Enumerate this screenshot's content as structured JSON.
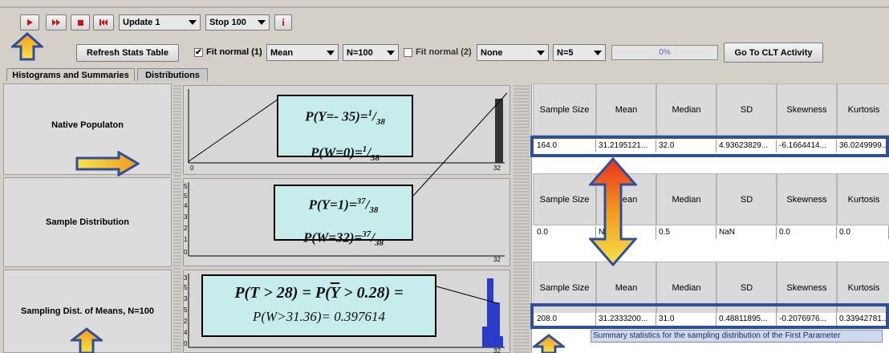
{
  "toolbar": {
    "update_select": "Update 1",
    "stop_select": "Stop 100",
    "info_label": "i"
  },
  "controls": {
    "refresh_label": "Refresh Stats Table",
    "fit1_label": "Fit normal (1)",
    "fit1_checked": true,
    "stat_select": "Mean",
    "n_select": "N=100",
    "fit2_label": "Fit normal (2)",
    "fit2_checked": false,
    "stat2_select": "None",
    "n2_select": "N=5",
    "progress_text": "0%",
    "progress_value": 0,
    "clt_label": "Go To CLT Activity"
  },
  "tabs": [
    {
      "label": "Histograms and Summaries"
    },
    {
      "label": "Distributions"
    }
  ],
  "panels": [
    {
      "label": "Native Populaton"
    },
    {
      "label": "Sample Distribution"
    },
    {
      "label": "Sampling Dist. of Means, N=100"
    }
  ],
  "plots": {
    "native": {
      "axis_left": "0",
      "axis_right": "32"
    },
    "sample": {
      "axis_left": "0",
      "axis_right": "32",
      "yticks": [
        "5",
        "5",
        "4",
        "3",
        "2",
        "1",
        "0"
      ]
    },
    "means": {
      "axis_left": "0",
      "axis_right": "32",
      "yticks": [
        "3",
        "5",
        "3",
        "5",
        "2",
        "4",
        "0"
      ]
    }
  },
  "formulas": {
    "f1_line1": "P(Y=- 35)=",
    "f1_line2": "P(W=0)=",
    "f1_num": "1",
    "f1_den": "38",
    "f2_line1": "P(Y=1)=",
    "f2_line2": "P(W=32)=",
    "f2_num": "37",
    "f2_den": "38",
    "f3_line1_a": "P(T > 28) = P(",
    "f3_line1_b": "Y",
    "f3_line1_c": " > 0.28) =",
    "f3_line2": "P(W>31.36)= 0.397614"
  },
  "table_headers": [
    "Sample Size",
    "Mean",
    "Median",
    "SD",
    "Skewness",
    "Kurtosis"
  ],
  "table_rows": [
    [
      "164.0",
      "31.2195121...",
      "32.0",
      "4.93623829...",
      "-6.1664414...",
      "36.0249999..."
    ],
    [
      "0.0",
      "N",
      "0.5",
      "NaN",
      "0.0",
      "0.0"
    ],
    [
      "208.0",
      "31.2333200...",
      "31.0",
      "0.48811895...",
      "-0.2076976...",
      "0.33942781..."
    ]
  ],
  "tooltip": "Summary statistics for the sampling distribution of the First Parameter",
  "colors": {
    "accent_blue": "#2f4f9a",
    "formula_bg": "#c6ecec",
    "arrow_orange": "#f29a1f",
    "arrow_yellow": "#f7e34a",
    "hist_blue": "#2a3cc8"
  }
}
